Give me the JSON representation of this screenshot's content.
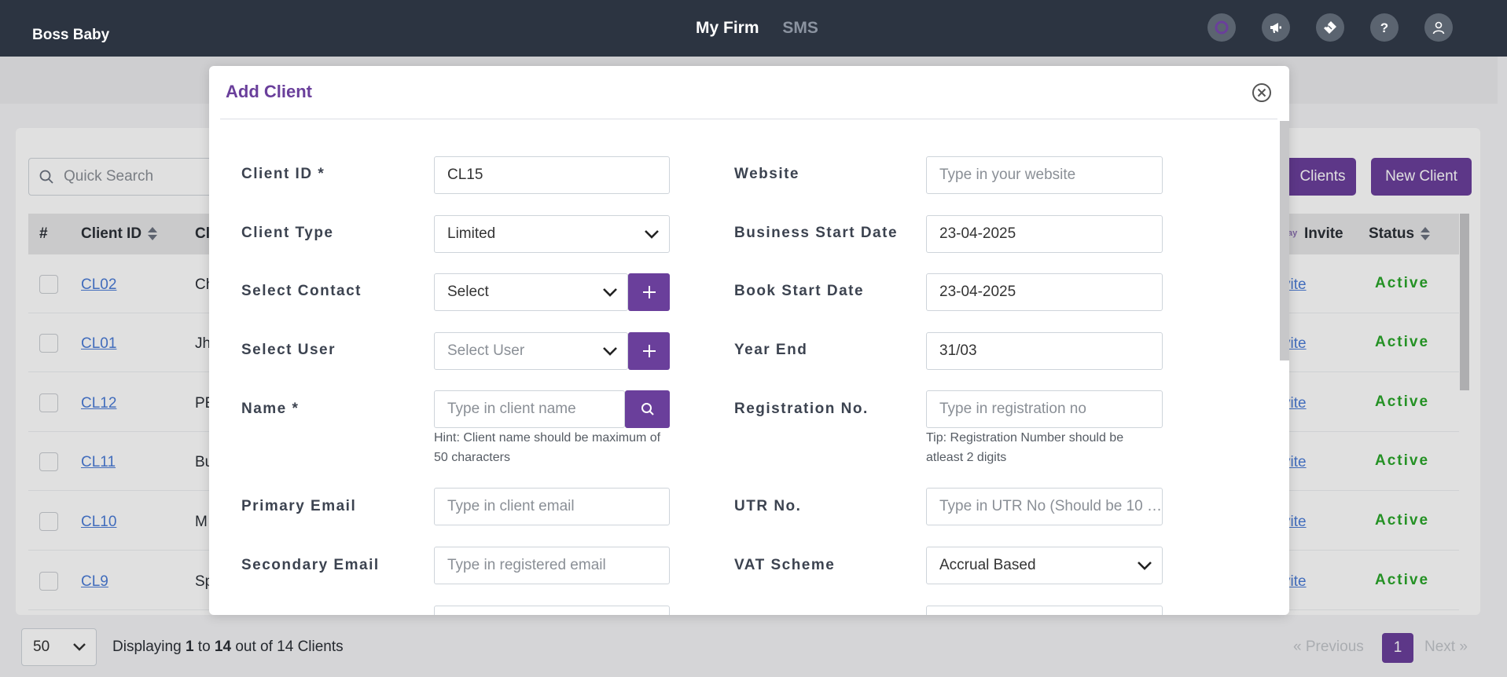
{
  "topbar": {
    "brand": "Boss Baby",
    "nav": [
      "My Firm",
      "SMS"
    ],
    "icons": [
      "spinner-icon",
      "megaphone-icon",
      "ticket-icon",
      "help-icon",
      "user-icon"
    ]
  },
  "list": {
    "search_placeholder": "Quick Search",
    "import_button": "Clients",
    "new_button": "New Client",
    "headers": {
      "hash": "#",
      "client_id": "Client ID",
      "client_name": "Cl",
      "invite": "Invite",
      "invite_prefix": "ay",
      "status": "Status"
    },
    "rows": [
      {
        "id": "CL02",
        "name": "Ch",
        "invite": "vite",
        "status": "Active"
      },
      {
        "id": "CL01",
        "name": "Jh",
        "invite": "vite",
        "status": "Active"
      },
      {
        "id": "CL12",
        "name": "PE",
        "invite": "vite",
        "status": "Active"
      },
      {
        "id": "CL11",
        "name": "Bu",
        "invite": "vite",
        "status": "Active"
      },
      {
        "id": "CL10",
        "name": "M",
        "invite": "vite",
        "status": "Active"
      },
      {
        "id": "CL9",
        "name": "Sp",
        "invite": "vite",
        "status": "Active"
      }
    ]
  },
  "footer": {
    "per_page": "50",
    "displaying_prefix": "Displaying ",
    "from": "1",
    "to_word": " to ",
    "to": "14",
    "suffix": " out of 14 Clients",
    "prev": "« Previous",
    "page": "1",
    "next": "Next »"
  },
  "modal": {
    "title": "Add Client",
    "left": {
      "client_id_label": "Client ID *",
      "client_id_value": "CL15",
      "client_type_label": "Client Type",
      "client_type_value": "Limited",
      "select_contact_label": "Select Contact",
      "select_contact_value": "Select",
      "select_user_label": "Select User",
      "select_user_placeholder": "Select User",
      "name_label": "Name *",
      "name_placeholder": "Type in client name",
      "name_hint": "Hint: Client name should be maximum of 50 characters",
      "primary_email_label": "Primary Email",
      "primary_email_placeholder": "Type in client email",
      "secondary_email_label": "Secondary Email",
      "secondary_email_placeholder": "Type in registered email"
    },
    "right": {
      "website_label": "Website",
      "website_placeholder": "Type in your website",
      "business_start_label": "Business Start Date",
      "business_start_value": "23-04-2025",
      "book_start_label": "Book Start Date",
      "book_start_value": "23-04-2025",
      "year_end_label": "Year End",
      "year_end_value": "31/03",
      "registration_label": "Registration No.",
      "registration_placeholder": "Type in registration no",
      "registration_hint": "Tip: Registration Number should be atleast 2 digits",
      "utr_label": "UTR No.",
      "utr_placeholder": "Type in UTR No (Should be 10 …",
      "vat_label": "VAT Scheme",
      "vat_value": "Accrual Based"
    }
  },
  "colors": {
    "accent": "#6a3f9b",
    "topbar": "#2c3441",
    "status_active": "#2aa52a",
    "link": "#4a7bd6"
  }
}
